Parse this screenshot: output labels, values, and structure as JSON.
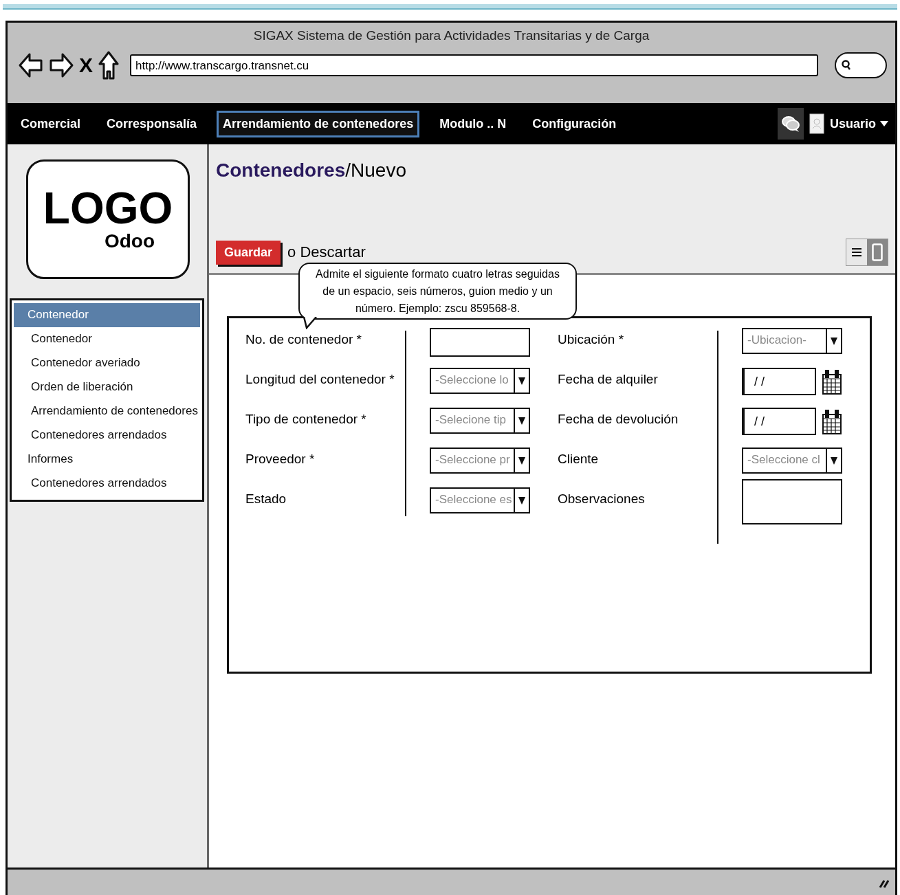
{
  "window": {
    "title": "SIGAX Sistema de Gestión para Actividades Transitarias y de Carga"
  },
  "browser": {
    "close_glyph": "X",
    "url": "http://www.transcargo.transnet.cu"
  },
  "nav": {
    "items": [
      {
        "label": "Comercial",
        "selected": false
      },
      {
        "label": "Corresponsalía",
        "selected": false
      },
      {
        "label": "Arrendamiento de contenedores",
        "selected": true
      },
      {
        "label": "Modulo .. N",
        "selected": false
      },
      {
        "label": "Configuración",
        "selected": false
      }
    ],
    "user": "Usuario"
  },
  "logo": {
    "title": "LOGO",
    "subtitle": "Odoo"
  },
  "sidebar": {
    "items": [
      {
        "label": "Contenedor",
        "selected": true,
        "children": [
          {
            "label": "Contenedor",
            "selected": false
          },
          {
            "label": "Contenedor averiado",
            "selected": false
          },
          {
            "label": "Orden de liberación",
            "selected": false
          },
          {
            "label": "Arrendamiento de contenedores",
            "selected": false
          },
          {
            "label": "Contenedores arrendados",
            "selected": false
          }
        ]
      },
      {
        "label": "Informes",
        "selected": false,
        "children": [
          {
            "label": "Contenedores arrendados",
            "selected": false
          }
        ]
      }
    ]
  },
  "breadcrumb": {
    "parent": "Contenedores",
    "separator": "/",
    "current": "Nuevo"
  },
  "actions": {
    "save": "Guardar",
    "discard": "o Descartar"
  },
  "view_toggle": [
    {
      "kind": "list",
      "selected": false
    },
    {
      "kind": "form",
      "selected": true
    }
  ],
  "tooltip": "Admite el siguiente formato cuatro letras seguidas de un espacio, seis números, guion medio y un número. Ejemplo: zscu 859568-8.",
  "form": {
    "left": [
      {
        "label": "No. de contenedor *",
        "kind": "text"
      },
      {
        "label": "Longitud del contenedor *",
        "kind": "select",
        "value": "-Seleccione lo"
      },
      {
        "label": "Tipo de contenedor *",
        "kind": "select",
        "value": "-Selecione tip"
      },
      {
        "label": "Proveedor *",
        "kind": "select",
        "value": "-Seleccione pr"
      },
      {
        "label": "Estado",
        "kind": "select",
        "value": "-Seleccione es"
      }
    ],
    "right": [
      {
        "label": "Ubicación *",
        "kind": "select",
        "value": "-Ubicacion-"
      },
      {
        "label": "Fecha de alquiler",
        "kind": "date",
        "value": "/ /"
      },
      {
        "label": "Fecha de devolución",
        "kind": "date",
        "value": "/ /"
      },
      {
        "label": "Cliente",
        "kind": "select",
        "value": "-Seleccione cl"
      },
      {
        "label": "Observaciones",
        "kind": "textarea"
      }
    ]
  }
}
